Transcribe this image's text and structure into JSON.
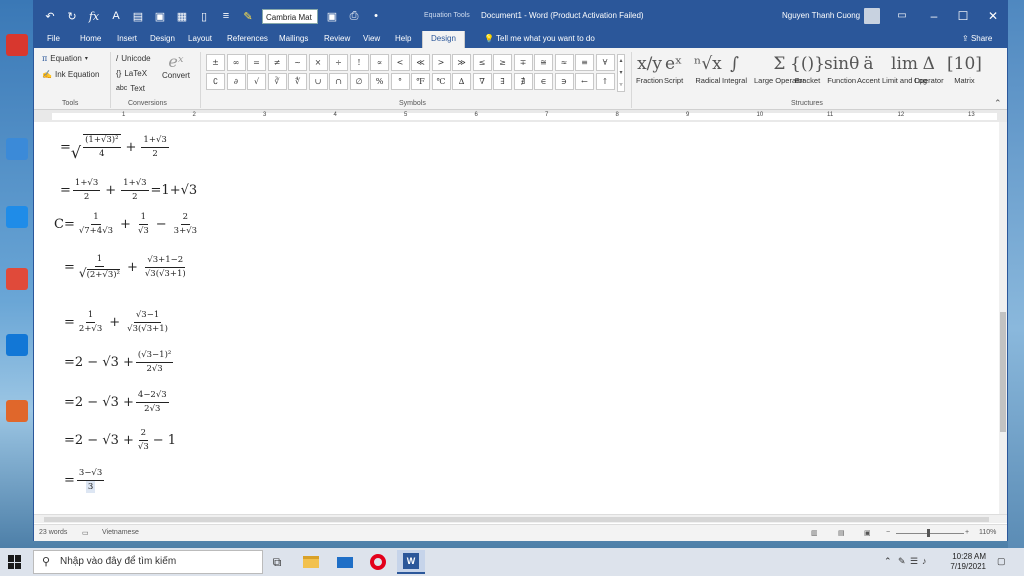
{
  "colors": {
    "word_blue": "#2b579a",
    "ribbon_bg": "#f3f3f3",
    "opera_red": "#e3001b"
  },
  "titlebar": {
    "font_name": "Cambria Mat",
    "contextual_label": "Equation Tools",
    "doc_title": "Document1 - Word (Product Activation Failed)",
    "user_name": "Nguyen Thanh Cuong",
    "ribbon_display_icon": "ribbon-display-icon",
    "minimize": "–",
    "maximize": "☐",
    "close": "✕"
  },
  "tabs": [
    "File",
    "Home",
    "Insert",
    "Design",
    "Layout",
    "References",
    "Mailings",
    "Review",
    "View",
    "Help"
  ],
  "active_tab": "Design",
  "tell_me": "Tell me what you want to do",
  "share": "Share",
  "ribbon": {
    "tools": {
      "equation": "Equation",
      "ink_equation": "Ink Equation",
      "label": "Tools"
    },
    "conversions": {
      "unicode": "Unicode",
      "latex": "LaTeX",
      "text": "Text",
      "convert": "Convert",
      "label": "Conversions"
    },
    "symbols_label": "Symbols",
    "symbols": [
      "±",
      "∞",
      "=",
      "≠",
      "~",
      "×",
      "÷",
      "!",
      "∝",
      "<",
      "≪",
      ">",
      "≫",
      "≤",
      "≥",
      "∓",
      "≅",
      "≈",
      "≡",
      "∀",
      "∁",
      "∂",
      "√",
      "∛",
      "∜",
      "∪",
      "∩",
      "∅",
      "%",
      "°",
      "℉",
      "℃",
      "∆",
      "∇",
      "∃",
      "∄",
      "∈",
      "∋",
      "←",
      "↑"
    ],
    "structures_label": "Structures",
    "structures": [
      {
        "icon": "x/y",
        "label": "Fraction"
      },
      {
        "icon": "eˣ",
        "label": "Script"
      },
      {
        "icon": "ⁿ√x",
        "label": "Radical"
      },
      {
        "icon": "∫",
        "label": "Integral"
      },
      {
        "icon": "Σ",
        "label": "Large Operator"
      },
      {
        "icon": "{()}",
        "label": "Bracket"
      },
      {
        "icon": "sinθ",
        "label": "Function"
      },
      {
        "icon": "ä",
        "label": "Accent"
      },
      {
        "icon": "lim",
        "label": "Limit and Log"
      },
      {
        "icon": "Δ",
        "label": "Operator"
      },
      {
        "icon": "[10]",
        "label": "Matrix"
      }
    ]
  },
  "ruler_numbers": [
    "1",
    "2",
    "3",
    "4",
    "5",
    "6",
    "7",
    "8",
    "9",
    "10",
    "11",
    "12",
    "13"
  ],
  "equations": {
    "e1": {
      "lead": "=",
      "n1": "(1+√3)²",
      "d1": "4",
      "op": "+",
      "n2": "1+√3",
      "d2": "2"
    },
    "e2": {
      "lead": "=",
      "n1": "1+√3",
      "d1": "2",
      "op": "+",
      "n2": "1+√3",
      "d2": "2",
      "tail": "=1+√3"
    },
    "e3": {
      "lead": "C=",
      "n1": "1",
      "d1": "√7+4√3",
      "op1": "+",
      "n2": "1",
      "d2": "√3",
      "op2": "−",
      "n3": "2",
      "d3": "3+√3"
    },
    "e4": {
      "lead": "=",
      "n1": "1",
      "d1": "(2+√3)²",
      "op": "+",
      "n2": "√3+1−2",
      "d2": "√3(√3+1)"
    },
    "e5": {
      "lead": "=",
      "n1": "1",
      "d1": "2+√3",
      "op": "+",
      "n2": "√3−1",
      "d2": "√3(√3+1)"
    },
    "e6": {
      "lead": "=2 − √3 +",
      "n1": "(√3−1)²",
      "d1": "2√3"
    },
    "e7": {
      "lead": "=2 − √3 +",
      "n1": "4−2√3",
      "d1": "2√3"
    },
    "e8": {
      "lead": "=2 − √3 +",
      "n1": "2",
      "d1": "√3",
      "tail": "− 1"
    },
    "e9": {
      "lead": "=",
      "n1": "3−√3",
      "d1": "3"
    }
  },
  "status": {
    "words": "23 words",
    "language": "Vietnamese",
    "zoom": "110%"
  },
  "taskbar": {
    "search_placeholder": "Nhập vào đây để tìm kiếm",
    "time": "10:28 AM",
    "date": "7/19/2021"
  }
}
